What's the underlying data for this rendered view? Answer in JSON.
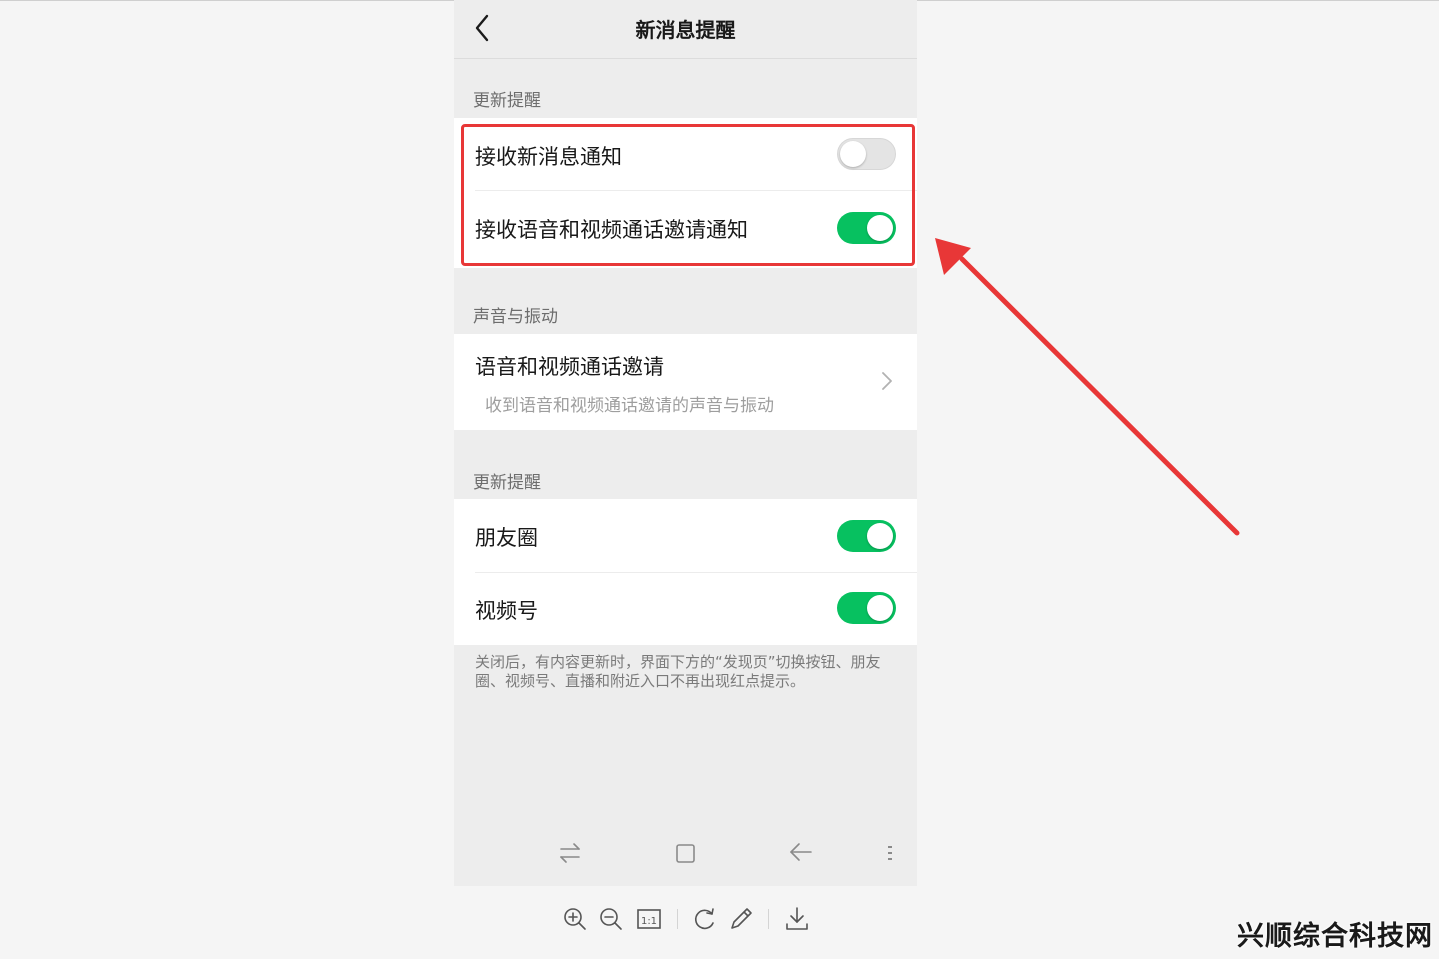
{
  "header": {
    "title": "新消息提醒"
  },
  "sections": {
    "notify_label": "更新提醒",
    "sound_label": "声音与振动",
    "update_label": "更新提醒"
  },
  "notify_group": {
    "items": [
      {
        "label": "接收新消息通知",
        "on": false
      },
      {
        "label": "接收语音和视频通话邀请通知",
        "on": true
      }
    ]
  },
  "sound_group": {
    "title": "语音和视频通话邀请",
    "subtitle": "收到语音和视频通话邀请的声音与振动"
  },
  "update_group": {
    "items": [
      {
        "label": "朋友圈",
        "on": true
      },
      {
        "label": "视频号",
        "on": true
      }
    ]
  },
  "note": "关闭后，有内容更新时，界面下方的“发现页”切换按钮、朋友圈、视频号、直播和附近入口不再出现红点提示。",
  "colors": {
    "accent_green": "#07c160",
    "annotation_red": "#e83737"
  },
  "icons": {
    "nav": [
      "switch-icon",
      "home-square-icon",
      "back-arrow-icon",
      "menu-icon"
    ],
    "toolbar": [
      "zoom-in-icon",
      "zoom-out-icon",
      "actual-size-icon",
      "rotate-icon",
      "edit-icon",
      "download-icon"
    ]
  },
  "toolbar": {
    "actual_size_label": "1:1"
  },
  "watermark": "兴顺综合科技网"
}
